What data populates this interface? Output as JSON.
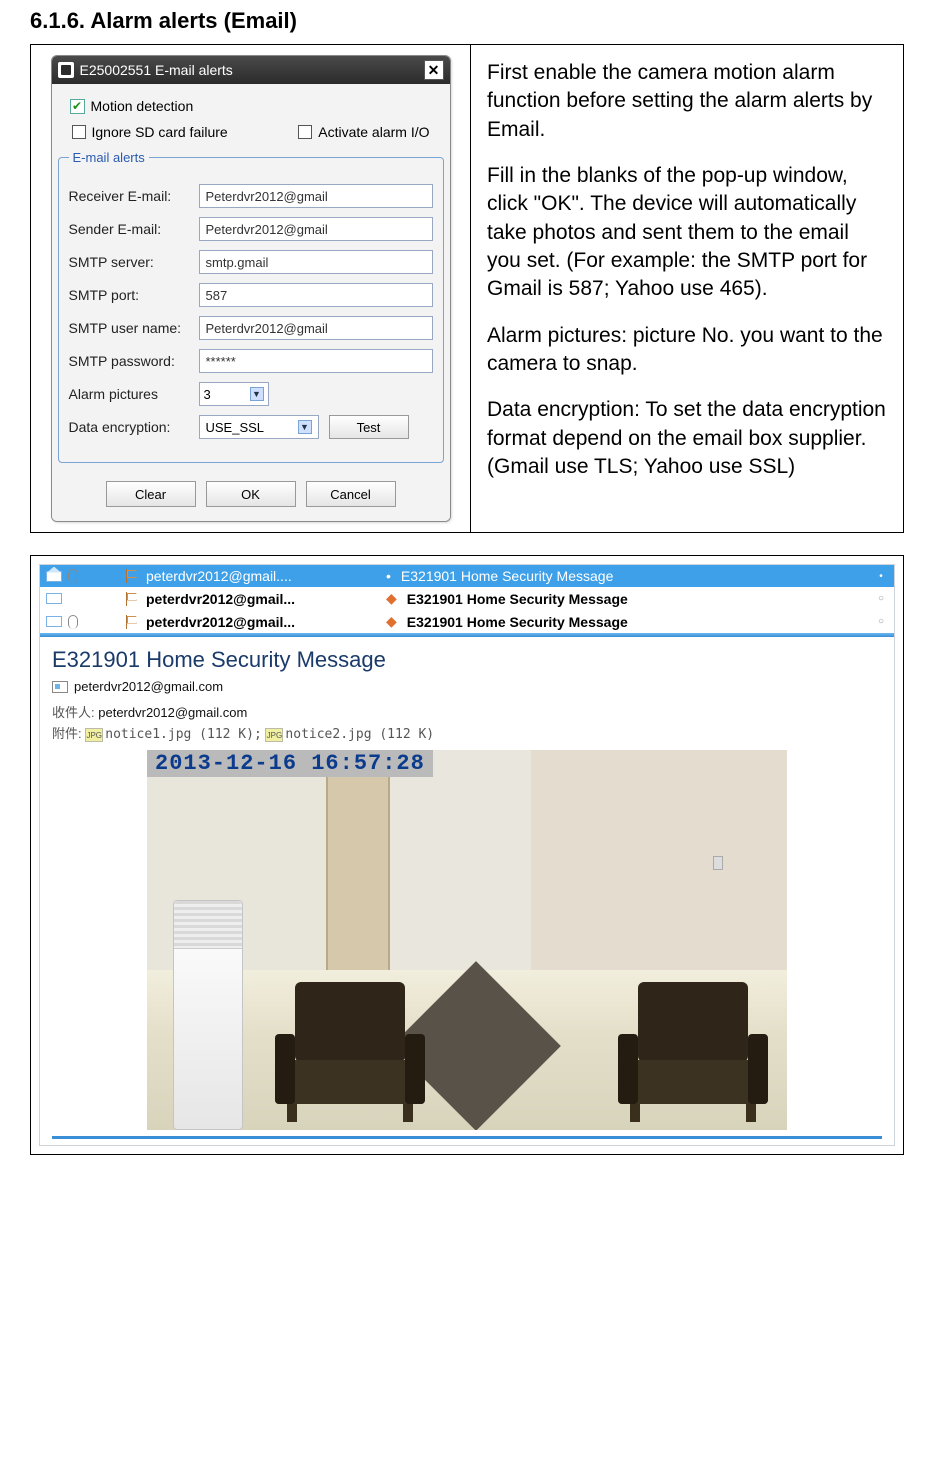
{
  "heading": "6.1.6.    Alarm alerts (Email)",
  "dialog": {
    "title": "E25002551 E-mail alerts",
    "motion_detection": "Motion detection",
    "ignore_sd": "Ignore SD card failure",
    "activate_io": "Activate alarm I/O",
    "legend": "E-mail alerts",
    "receiver_label": "Receiver E-mail:",
    "receiver_value": "Peterdvr2012@gmail",
    "sender_label": "Sender E-mail:",
    "sender_value": "Peterdvr2012@gmail",
    "smtp_server_label": "SMTP server:",
    "smtp_server_value": "smtp.gmail",
    "smtp_port_label": "SMTP port:",
    "smtp_port_value": "587",
    "smtp_user_label": "SMTP user name:",
    "smtp_user_value": "Peterdvr2012@gmail",
    "smtp_pass_label": "SMTP password:",
    "smtp_pass_value": "******",
    "alarm_pics_label": "Alarm pictures",
    "alarm_pics_value": "3",
    "data_enc_label": "Data encryption:",
    "data_enc_value": "USE_SSL",
    "test_btn": "Test",
    "clear_btn": "Clear",
    "ok_btn": "OK",
    "cancel_btn": "Cancel"
  },
  "instructions": {
    "p1": "First enable the camera motion alarm function before setting the alarm alerts by Email.",
    "p2": "Fill in the blanks of the pop-up window, click \"OK\". The device will automatically take photos and sent them to the email you set. (For example: the SMTP port for Gmail is 587; Yahoo use 465).",
    "p3": "Alarm pictures: picture No. you want to the camera to snap.",
    "p4": "Data encryption: To set the data encryption format depend on the email box supplier.(Gmail use TLS; Yahoo use SSL)"
  },
  "inbox": {
    "rows": [
      {
        "sender": "peterdvr2012@gmail....",
        "subject": "E321901 Home Security Message"
      },
      {
        "sender": "peterdvr2012@gmail...",
        "subject": "E321901 Home Security Message"
      },
      {
        "sender": "peterdvr2012@gmail...",
        "subject": "E321901 Home Security Message"
      }
    ]
  },
  "message": {
    "title": "E321901 Home Security Message",
    "from": "peterdvr2012@gmail.com",
    "to_label": "收件人:",
    "to": "peterdvr2012@gmail.com",
    "attach_label": "附件:",
    "attach1": "notice1.jpg (112 K);",
    "attach2": "notice2.jpg (112 K)",
    "timestamp": "2013-12-16 16:57:28"
  }
}
